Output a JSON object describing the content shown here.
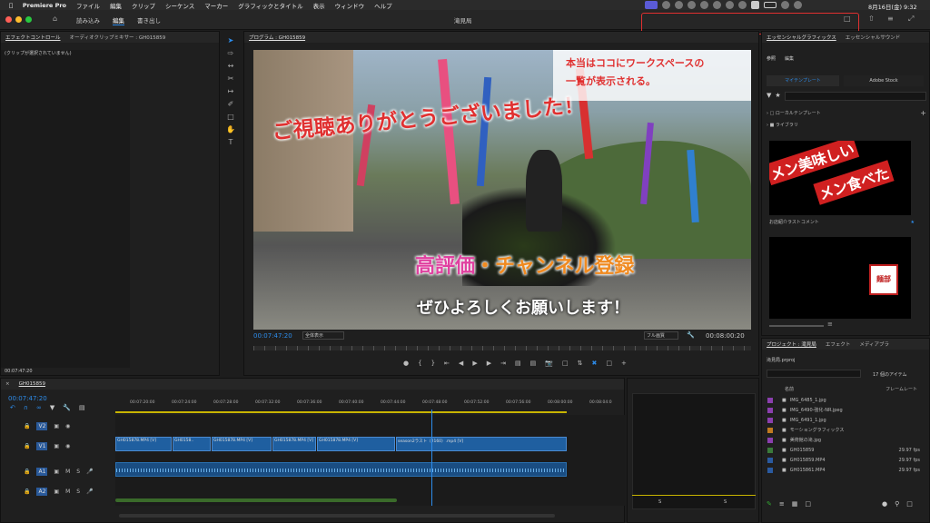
{
  "menubar": {
    "app": "Premiere Pro",
    "items": [
      "ファイル",
      "編集",
      "クリップ",
      "シーケンス",
      "マーカー",
      "グラフィックとタイトル",
      "表示",
      "ウィンドウ",
      "ヘルプ"
    ],
    "datetime": "8月16日(金) 9:32"
  },
  "titlebar": {
    "tabs": [
      "読み込み",
      "編集",
      "書き出し"
    ],
    "active": "編集",
    "title": "滝見局"
  },
  "effect_panel": {
    "tabs": [
      "エフェクトコントロール",
      "オーディオクリップミキサー : GH015859"
    ],
    "empty": "(クリップが選択されていません)",
    "time": "00:07:47:20"
  },
  "program": {
    "title": "プログラム : GH015859",
    "timecode": "00:07:47:20",
    "fit": "全体表示",
    "quality": "フル画質",
    "duration": "00:08:00:20"
  },
  "overlay": {
    "line1": "ご視聴ありがとうございました！",
    "line2a": "高評価",
    "line2b": "・チャンネル登録",
    "line3": "ぜひよろしくお願いします！"
  },
  "annotation": {
    "line1": "本当はココにワークスペースの",
    "line2": "一覧が表示される。"
  },
  "essential": {
    "tabs": [
      "エッセンシャルグラフィックス",
      "エッセンシャルサウンド"
    ],
    "subtabs": [
      "参照",
      "編集"
    ],
    "mytemplates": "マイテンプレート",
    "stock": "Adobe Stock",
    "local": "ローカルテンプレート",
    "library": "ライブラリ",
    "thumb_label": "お店紹介ラストコメント",
    "thumb_text1": "メン美味しい",
    "thumb_text2": "メン食べた",
    "stamp": "麺部"
  },
  "project": {
    "tabs": [
      "プロジェクト : 滝見局",
      "エフェクト",
      "メディアブラ"
    ],
    "file": "滝見局.prproj",
    "count": "17 個のアイテム",
    "col_name": "名前",
    "col_rate": "フレームレート",
    "items": [
      {
        "name": "IMG_6485_1.jpg",
        "rate": "",
        "color": "#8a3fae"
      },
      {
        "name": "IMG_6490-強化-NR.jpeg",
        "rate": "",
        "color": "#8a3fae"
      },
      {
        "name": "IMG_6491_1.jpg",
        "rate": "",
        "color": "#8a3fae"
      },
      {
        "name": "モーショングラフィックス",
        "rate": "",
        "color": "#c07a20"
      },
      {
        "name": "美術館の滝.jpg",
        "rate": "",
        "color": "#8a3fae"
      },
      {
        "name": "GH015859",
        "rate": "29.97 fps",
        "color": "#3a7a3a"
      },
      {
        "name": "GH015859.MP4",
        "rate": "29.97 fps",
        "color": "#2a5aa0"
      },
      {
        "name": "GH015861.MP4",
        "rate": "29.97 fps",
        "color": "#2a5aa0"
      }
    ]
  },
  "timeline": {
    "seq": "GH015859",
    "timecode": "00:07:47:20",
    "ruler": [
      "00:07:20:00",
      "00:07:24:00",
      "00:07:28:00",
      "00:07:32:00",
      "00:07:36:00",
      "00:07:40:00",
      "00:07:44:00",
      "00:07:48:00",
      "00:07:52:00",
      "00:07:56:00",
      "00:08:00:00",
      "00:08:04:0"
    ],
    "tracks": [
      "V2",
      "V1",
      "A1",
      "A2"
    ],
    "clips": [
      "GH015878.MP4 [V]",
      "GH0158..",
      "GH015878.MP4 [V]",
      "GH015878.MP4 [V]",
      "GH015878.MP4 [V]",
      "season2ラスト（2160）.mp4 [V]"
    ]
  },
  "colors": {
    "accent": "#2d8ceb",
    "annotation_border": "#e03030",
    "pink": "#e8408a",
    "orange": "#f08a20"
  }
}
